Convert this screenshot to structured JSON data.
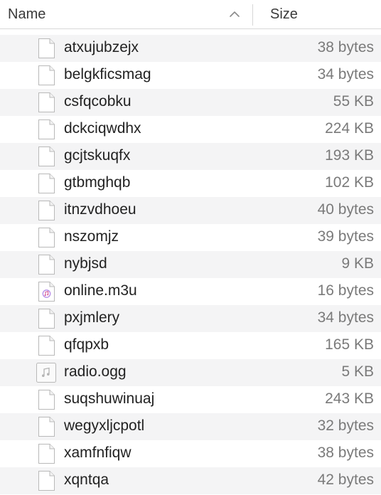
{
  "header": {
    "name_label": "Name",
    "size_label": "Size",
    "sort_icon": "chevron-up-icon"
  },
  "files": [
    {
      "name": "atxujubzejx",
      "size": "38 bytes",
      "icon": "document-icon"
    },
    {
      "name": "belgkficsmag",
      "size": "34 bytes",
      "icon": "document-icon"
    },
    {
      "name": "csfqcobku",
      "size": "55 KB",
      "icon": "document-icon"
    },
    {
      "name": "dckciqwdhx",
      "size": "224 KB",
      "icon": "document-icon"
    },
    {
      "name": "gcjtskuqfx",
      "size": "193 KB",
      "icon": "document-icon"
    },
    {
      "name": "gtbmghqb",
      "size": "102 KB",
      "icon": "document-icon"
    },
    {
      "name": "itnzvdhoeu",
      "size": "40 bytes",
      "icon": "document-icon"
    },
    {
      "name": "nszomjz",
      "size": "39 bytes",
      "icon": "document-icon"
    },
    {
      "name": "nybjsd",
      "size": "9 KB",
      "icon": "document-icon"
    },
    {
      "name": "online.m3u",
      "size": "16 bytes",
      "icon": "playlist-icon"
    },
    {
      "name": "pxjmlery",
      "size": "34 bytes",
      "icon": "document-icon"
    },
    {
      "name": "qfqpxb",
      "size": "165 KB",
      "icon": "document-icon"
    },
    {
      "name": "radio.ogg",
      "size": "5 KB",
      "icon": "audio-file-icon"
    },
    {
      "name": "suqshuwinuaj",
      "size": "243 KB",
      "icon": "document-icon"
    },
    {
      "name": "wegyxljcpotl",
      "size": "32 bytes",
      "icon": "document-icon"
    },
    {
      "name": "xamfnfiqw",
      "size": "38 bytes",
      "icon": "document-icon"
    },
    {
      "name": "xqntqa",
      "size": "42 bytes",
      "icon": "document-icon"
    }
  ],
  "colors": {
    "row_alt": "#f4f4f5",
    "size_text": "#7a7a7a",
    "name_text": "#222222"
  }
}
